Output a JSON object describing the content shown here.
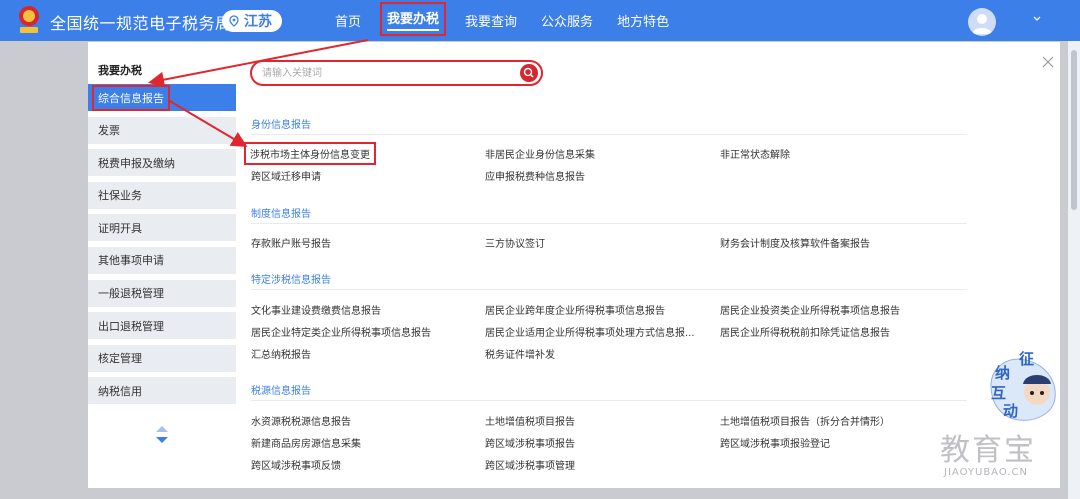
{
  "header": {
    "site_title": "全国统一规范电子税务局",
    "region": "江苏",
    "nav": [
      "首页",
      "我要办税",
      "我要查询",
      "公众服务",
      "地方特色"
    ]
  },
  "sidebar": {
    "title": "我要办税",
    "items": [
      "综合信息报告",
      "发票",
      "税费申报及缴纳",
      "社保业务",
      "证明开具",
      "其他事项申请",
      "一般退税管理",
      "出口退税管理",
      "核定管理",
      "纳税信用"
    ]
  },
  "search": {
    "placeholder": "请输入关键词"
  },
  "sections": [
    {
      "title": "身份信息报告",
      "items": [
        "涉税市场主体身份信息变更",
        "非居民企业身份信息采集",
        "非正常状态解除",
        "跨区域迁移申请",
        "应申报税费种信息报告"
      ]
    },
    {
      "title": "制度信息报告",
      "items": [
        "存款账户账号报告",
        "三方协议签订",
        "财务会计制度及核算软件备案报告"
      ]
    },
    {
      "title": "特定涉税信息报告",
      "items": [
        "文化事业建设费缴费信息报告",
        "居民企业跨年度企业所得税事项信息报告",
        "居民企业投资类企业所得税事项信息报告",
        "居民企业特定类企业所得税事项信息报告",
        "居民企业适用企业所得税事项处理方式信息报...",
        "居民企业所得税税前扣除凭证信息报告",
        "汇总纳税报告",
        "税务证件增补发"
      ]
    },
    {
      "title": "税源信息报告",
      "items": [
        "水资源税税源信息报告",
        "土地增值税项目报告",
        "土地增值税项目报告（拆分合并情形）",
        "新建商品房房源信息采集",
        "跨区域涉税事项报告",
        "跨区域涉税事项报验登记",
        "跨区域涉税事项反馈",
        "跨区域涉税事项管理"
      ]
    }
  ],
  "mascot_text": [
    "征",
    "纳",
    "互",
    "动"
  ],
  "watermark": {
    "big": "教育宝",
    "small": "JIAOYUBAO.CN"
  },
  "colors": {
    "primary": "#3c7fe8",
    "highlight": "#e0262e"
  }
}
